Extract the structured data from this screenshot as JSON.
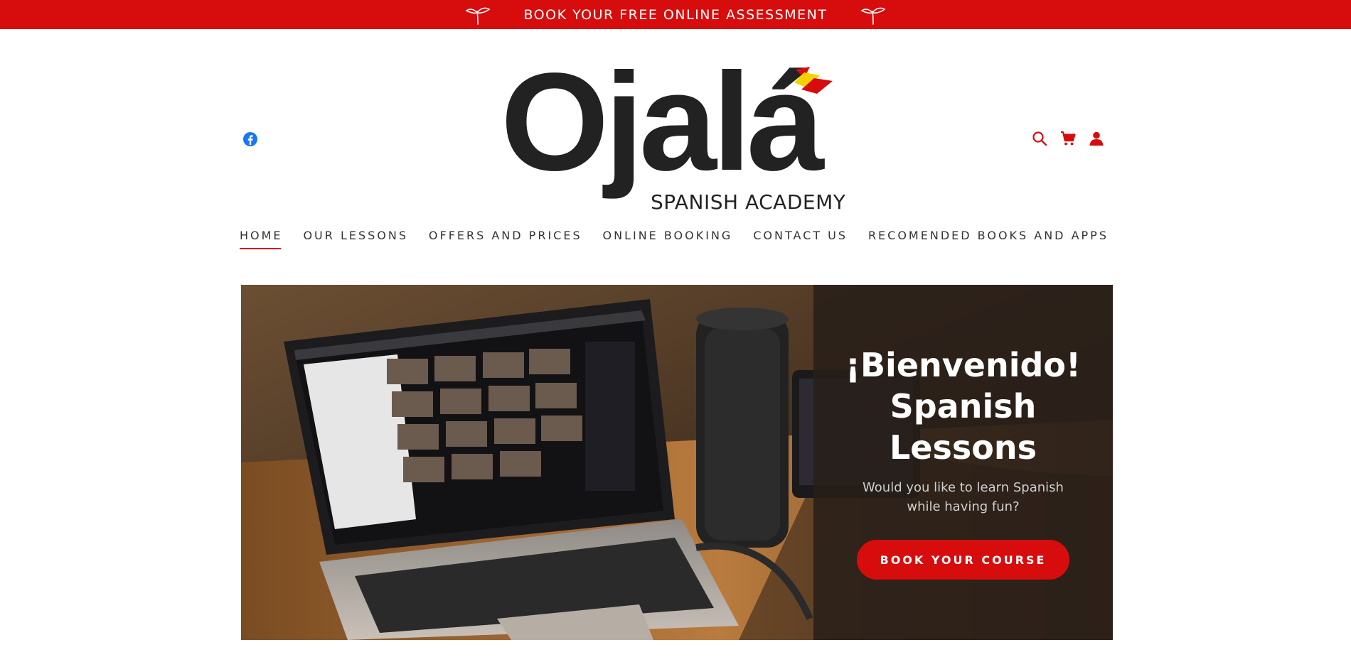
{
  "promo": {
    "text": "BOOK YOUR FREE ONLINE ASSESSMENT",
    "background": "#d70c0c"
  },
  "header": {
    "social": [
      "facebook-icon"
    ],
    "icons": [
      "search-icon",
      "cart-icon",
      "account-icon"
    ],
    "accent_color": "#d70c0c",
    "logo": {
      "word": "Ojalá",
      "subtitle": "SPANISH ACADEMY"
    }
  },
  "nav": {
    "items": [
      {
        "label": "HOME",
        "active": true
      },
      {
        "label": "OUR LESSONS",
        "active": false
      },
      {
        "label": "OFFERS AND PRICES",
        "active": false
      },
      {
        "label": "ONLINE BOOKING",
        "active": false
      },
      {
        "label": "CONTACT US",
        "active": false
      },
      {
        "label": "RECOMENDED BOOKS AND APPS",
        "active": false
      }
    ]
  },
  "hero": {
    "title_lines": [
      "¡Bienvenido!",
      "Spanish",
      "Lessons"
    ],
    "subtitle": "Would you like to learn Spanish while having fun?",
    "button_label": "BOOK YOUR COURSE"
  }
}
